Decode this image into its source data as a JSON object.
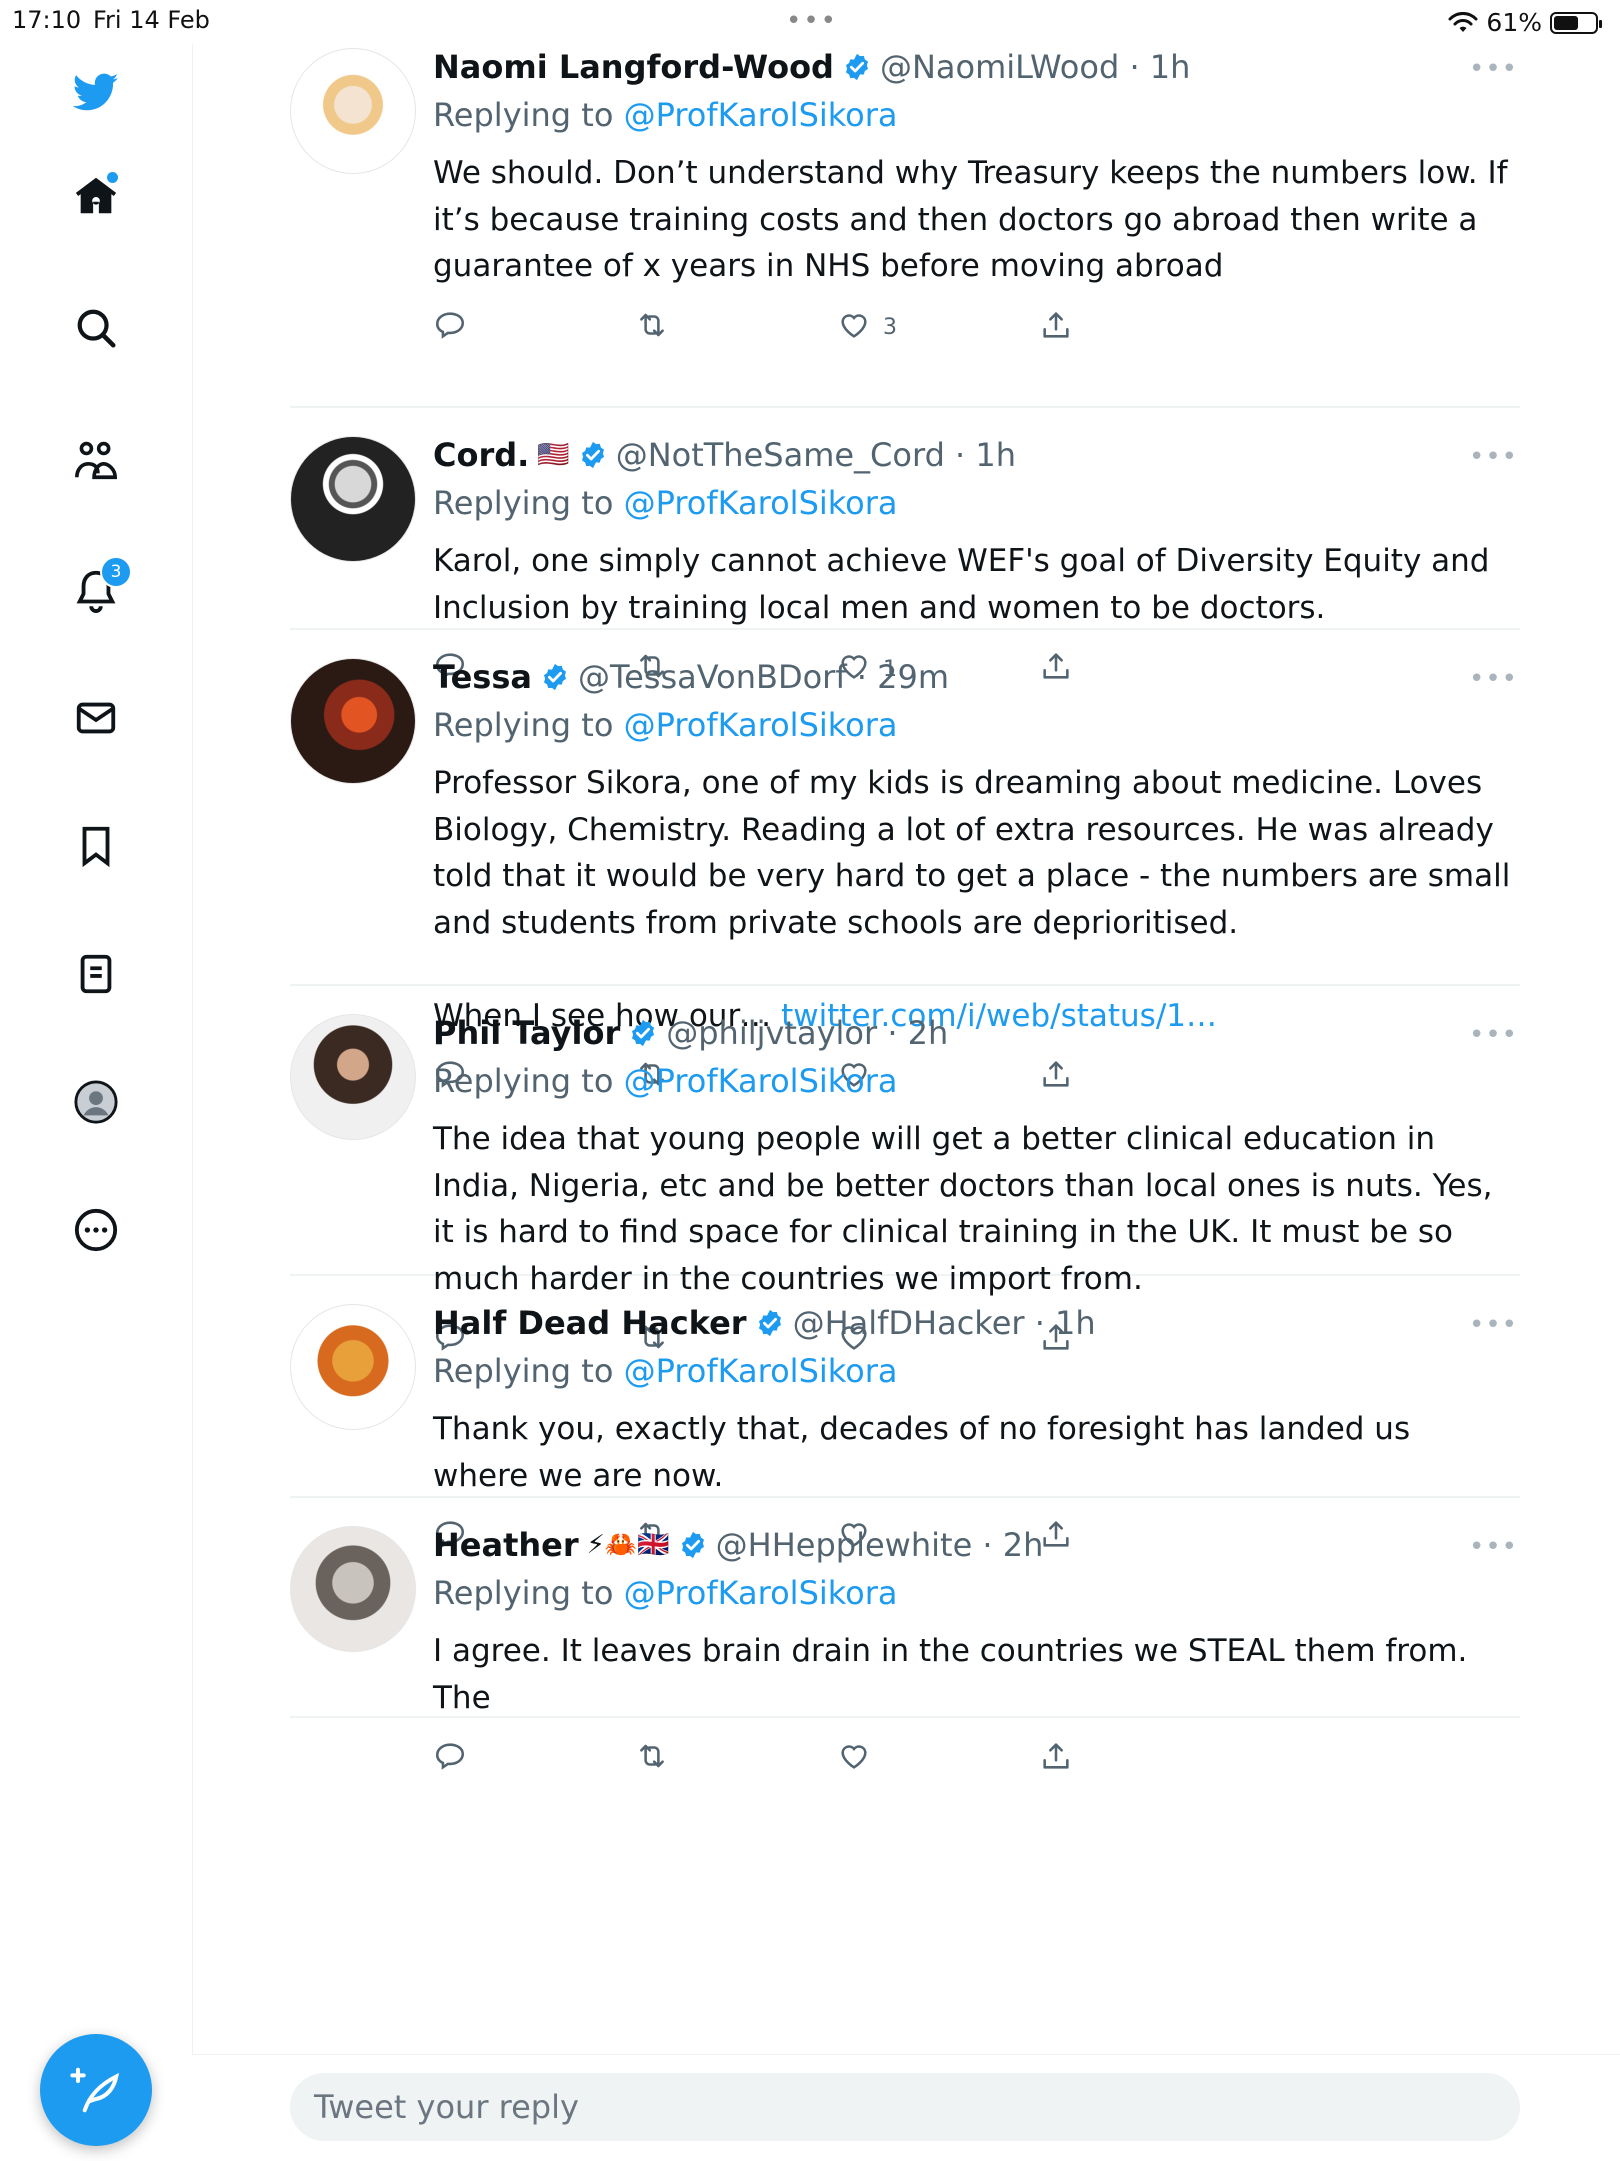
{
  "status_bar": {
    "time": "17:10",
    "date": "Fri 14 Feb",
    "battery": "61%",
    "battery_level": 0.61
  },
  "sidebar": {
    "items": [
      {
        "name": "twitter-logo-icon"
      },
      {
        "name": "home-icon",
        "has_dot": true
      },
      {
        "name": "search-icon"
      },
      {
        "name": "communities-icon"
      },
      {
        "name": "notifications-icon",
        "badge": "3"
      },
      {
        "name": "messages-icon"
      },
      {
        "name": "bookmarks-icon"
      },
      {
        "name": "lists-icon"
      },
      {
        "name": "profile-icon"
      },
      {
        "name": "more-icon"
      }
    ],
    "compose_label": "Tweet"
  },
  "tweets": [
    {
      "name": "Naomi Langford-Wood",
      "flags": "",
      "handle": "@NaomiLWood · 1h",
      "replying_prefix": "Replying to",
      "replying_to": "@ProfKarolSikora",
      "text": "We should. Don’t understand why Treasury keeps the numbers low. If it’s because training costs and then doctors go abroad then write a guarantee of x years in NHS before moving abroad",
      "link": "",
      "likes": "3"
    },
    {
      "name": "Cord.",
      "flags": "🇺🇸",
      "handle": "@NotTheSame_Cord · 1h",
      "replying_prefix": "Replying to",
      "replying_to": "@ProfKarolSikora",
      "text": "Karol, one simply cannot achieve WEF's goal of Diversity Equity and Inclusion by training local men and women to be doctors.",
      "link": "",
      "likes": "1"
    },
    {
      "name": "Tessa",
      "flags": "",
      "handle": "@TessaVonBDorf · 29m",
      "replying_prefix": "Replying to",
      "replying_to": "@ProfKarolSikora",
      "text": "Professor Sikora, one of my kids is dreaming about medicine. Loves Biology, Chemistry. Reading a lot of extra resources. He was already told that it would be very hard to get a place - the numbers are small and students from private schools are deprioritised.\n\nWhen I see how our…",
      "link": "twitter.com/i/web/status/1…",
      "likes": ""
    },
    {
      "name": "Phil Taylor",
      "flags": "",
      "handle": "@philjvtaylor · 2h",
      "replying_prefix": "Replying to",
      "replying_to": "@ProfKarolSikora",
      "text": "The idea that young people will get a better clinical education in India, Nigeria, etc and be better doctors than local ones is nuts. Yes, it is hard to find space for clinical training in the UK. It must be so much harder in the countries we import from.",
      "link": "",
      "likes": ""
    },
    {
      "name": "Half Dead Hacker",
      "flags": "",
      "handle": "@HalfDHacker · 1h",
      "replying_prefix": "Replying to",
      "replying_to": "@ProfKarolSikora",
      "text": "Thank you, exactly that, decades of no foresight has landed us where we are now.",
      "link": "",
      "likes": ""
    },
    {
      "name": "Heather",
      "flags": "⚡🦀🇬🇧",
      "handle": "@HHepplewhite · 2h",
      "replying_prefix": "Replying to",
      "replying_to": "@ProfKarolSikora",
      "text": "I agree. It leaves brain drain in the countries we STEAL them from. The",
      "link": "",
      "likes": ""
    }
  ],
  "reply_box": {
    "placeholder": "Tweet your reply"
  },
  "colors": {
    "accent": "#1d9bf0",
    "text": "#0f1419",
    "muted": "#536471"
  }
}
